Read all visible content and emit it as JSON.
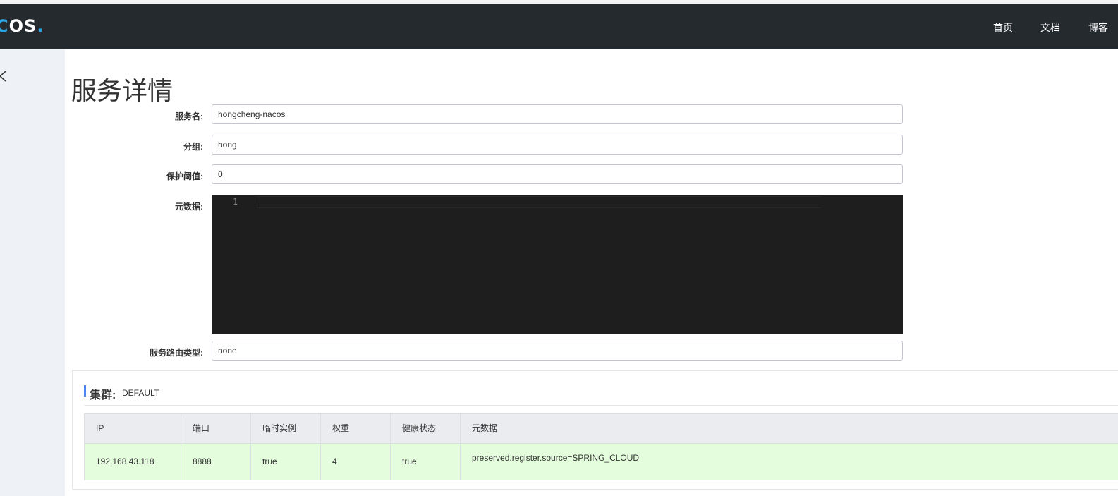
{
  "header": {
    "logo_main": "O",
    "logo_s": "S",
    "logo_dot": ".",
    "nav": [
      "首页",
      "文档",
      "博客"
    ]
  },
  "page": {
    "title": "服务详情"
  },
  "form": {
    "service_name_label": "服务名:",
    "service_name_value": "hongcheng-nacos",
    "group_label": "分组:",
    "group_value": "hong",
    "threshold_label": "保护阈值:",
    "threshold_value": "0",
    "metadata_label": "元数据:",
    "metadata_line_number": "1",
    "selector_label": "服务路由类型:",
    "selector_value": "none"
  },
  "cluster": {
    "label": "集群:",
    "name": "DEFAULT",
    "columns": [
      "IP",
      "端口",
      "临时实例",
      "权重",
      "健康状态",
      "元数据"
    ],
    "rows": [
      {
        "ip": "192.168.43.118",
        "port": "8888",
        "ephemeral": "true",
        "weight": "4",
        "healthy": "true",
        "metadata": "preserved.register.source=SPRING_CLOUD"
      }
    ]
  },
  "colors": {
    "header_bg": "#252a2f",
    "accent": "#4d83f2",
    "row_bg": "#e4fddd",
    "editor_bg": "#1e1e1e"
  }
}
